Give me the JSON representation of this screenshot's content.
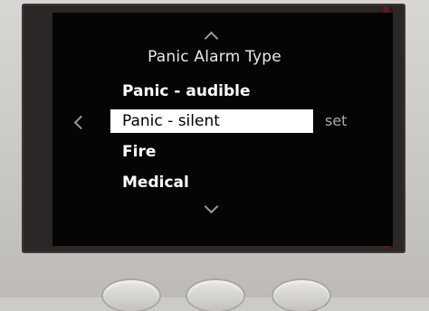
{
  "screen": {
    "title": "Panic Alarm Type",
    "options": [
      {
        "label": "Panic - audible",
        "selected": false
      },
      {
        "label": "Panic - silent",
        "selected": true
      },
      {
        "label": "Fire",
        "selected": false
      },
      {
        "label": "Medical",
        "selected": false
      }
    ],
    "set_label": "set"
  },
  "icons": {
    "scroll_up": "chevron-up-icon",
    "scroll_down": "chevron-down-icon",
    "back": "chevron-left-icon"
  },
  "colors": {
    "screen_background": "#050505",
    "text": "#ffffff",
    "selection_background": "#ffffff",
    "selection_text": "#000000",
    "device_body": "#cdcbc8"
  }
}
